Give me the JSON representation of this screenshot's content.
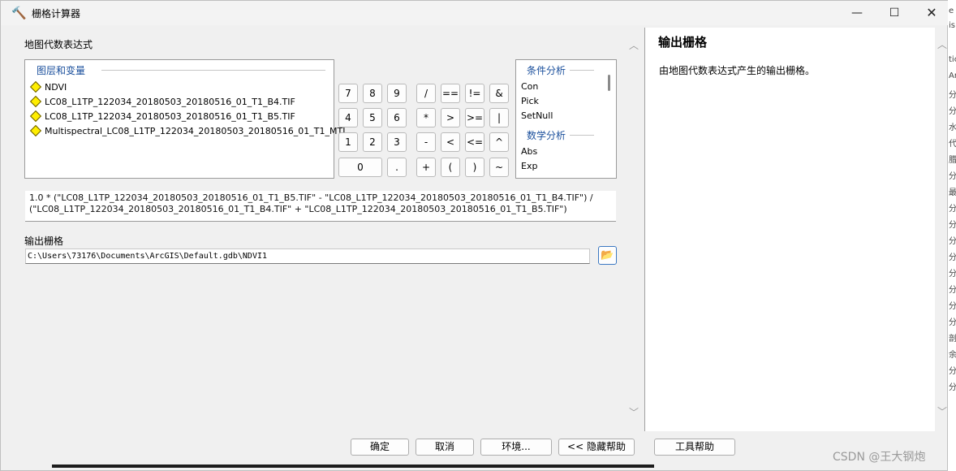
{
  "window": {
    "title": "栅格计算器",
    "icon": "hammer-icon",
    "minimize_icon": "—",
    "maximize_icon": "☐",
    "close_icon": "✕"
  },
  "expression_label": "地图代数表达式",
  "layers": {
    "title": "图层和变量",
    "items": [
      "NDVI",
      "LC08_L1TP_122034_20180503_20180516_01_T1_B4.TIF",
      "LC08_L1TP_122034_20180503_20180516_01_T1_B5.TIF",
      "Multispectral_LC08_L1TP_122034_20180503_20180516_01_T1_MTL"
    ]
  },
  "calculator": {
    "row1": [
      "7",
      "8",
      "9",
      "/",
      "==",
      "!=",
      "&"
    ],
    "row2": [
      "4",
      "5",
      "6",
      "*",
      ">",
      ">=",
      "|"
    ],
    "row3": [
      "1",
      "2",
      "3",
      "-",
      "<",
      "<=",
      "^"
    ],
    "row4": [
      "0",
      ".",
      "+",
      "(",
      ")",
      "~"
    ]
  },
  "functions": {
    "group1_title": "条件分析",
    "group1": [
      "Con",
      "Pick",
      "SetNull"
    ],
    "group2_title": "数学分析",
    "group2": [
      "Abs",
      "Exp"
    ]
  },
  "expression": {
    "line1": "1.0 * (\"LC08_L1TP_122034_20180503_20180516_01_T1_B5.TIF\" - \"LC08_L1TP_122034_20180503_20180516_01_T1_B4.TIF\") /",
    "line2": "(\"LC08_L1TP_122034_20180503_20180516_01_T1_B4.TIF\" + \"LC08_L1TP_122034_20180503_20180516_01_T1_B5.TIF\")"
  },
  "output": {
    "label": "输出栅格",
    "value": "C:\\Users\\73176\\Documents\\ArcGIS\\Default.gdb\\NDVI1"
  },
  "help": {
    "title": "输出栅格",
    "body": "由地图代数表达式产生的输出栅格。"
  },
  "buttons": {
    "ok": "确定",
    "cancel": "取消",
    "environments": "环境...",
    "hide_help": "<< 隐藏帮助",
    "tool_help": "工具帮助"
  },
  "right_strip": [
    "e",
    "is",
    "",
    "tic",
    "Ar",
    "分",
    "分",
    "水",
    "代",
    "腊",
    "分",
    "最",
    "分",
    "分",
    "分",
    "分",
    "分",
    "分",
    "分",
    "分",
    "剖",
    "余",
    "分",
    "分"
  ],
  "watermark": "CSDN @王大钢炮"
}
